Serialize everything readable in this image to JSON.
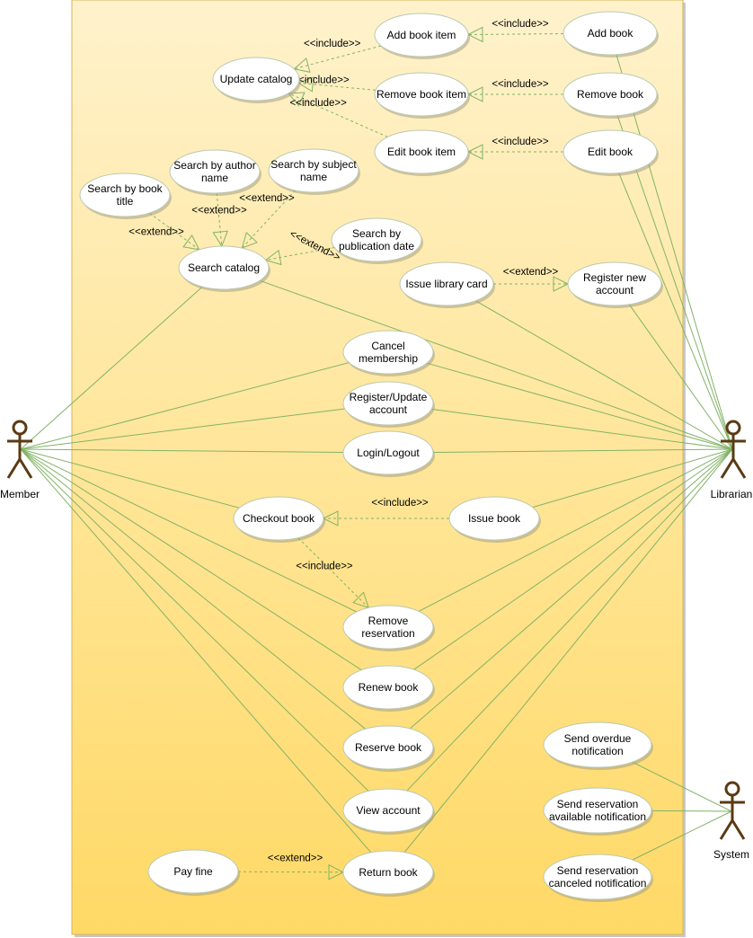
{
  "diagram": {
    "type": "UML use case diagram",
    "colors": {
      "boundary_fill_top": "#fff2cc",
      "boundary_fill_bottom": "#ffd966",
      "boundary_stroke": "#d6b656",
      "association": "#82b366",
      "actor": "#5b3a13",
      "ellipse_fill": "#ffffff"
    }
  },
  "actors": {
    "member": "Member",
    "librarian": "Librarian",
    "system": "System"
  },
  "use_cases": {
    "update_catalog": [
      "Update catalog"
    ],
    "add_book_item": [
      "Add book item"
    ],
    "remove_book_item": [
      "Remove book item"
    ],
    "edit_book_item": [
      "Edit book item"
    ],
    "add_book": [
      "Add book"
    ],
    "remove_book": [
      "Remove book"
    ],
    "edit_book": [
      "Edit book"
    ],
    "search_by_book_title": [
      "Search by book",
      "title"
    ],
    "search_by_author_name": [
      "Search by author",
      "name"
    ],
    "search_by_subject_name": [
      "Search by subject",
      "name"
    ],
    "search_by_publication_date": [
      "Search by",
      "publication date"
    ],
    "search_catalog": [
      "Search catalog"
    ],
    "issue_library_card": [
      "Issue library card"
    ],
    "register_new_account": [
      "Register new",
      "account"
    ],
    "cancel_membership": [
      "Cancel",
      "membership"
    ],
    "register_update_account": [
      "Register/Update",
      "account"
    ],
    "login_logout": [
      "Login/Logout"
    ],
    "checkout_book": [
      "Checkout book"
    ],
    "issue_book": [
      "Issue book"
    ],
    "remove_reservation": [
      "Remove",
      "reservation"
    ],
    "renew_book": [
      "Renew book"
    ],
    "reserve_book": [
      "Reserve book"
    ],
    "view_account": [
      "View account"
    ],
    "pay_fine": [
      "Pay fine"
    ],
    "return_book": [
      "Return book"
    ],
    "send_overdue_notification": [
      "Send overdue",
      "notification"
    ],
    "send_reservation_available_notification": [
      "Send reservation",
      "available notification"
    ],
    "send_reservation_canceled_notification": [
      "Send reservation",
      "canceled notification"
    ]
  },
  "relationships": [
    {
      "from": "add_book_item",
      "to": "update_catalog",
      "label": "<<include>>"
    },
    {
      "from": "remove_book_item",
      "to": "update_catalog",
      "label": "<<include>>"
    },
    {
      "from": "edit_book_item",
      "to": "update_catalog",
      "label": "<<include>>"
    },
    {
      "from": "add_book",
      "to": "add_book_item",
      "label": "<<include>>"
    },
    {
      "from": "remove_book",
      "to": "remove_book_item",
      "label": "<<include>>"
    },
    {
      "from": "edit_book",
      "to": "edit_book_item",
      "label": "<<include>>"
    },
    {
      "from": "search_by_book_title",
      "to": "search_catalog",
      "label": "<<extend>>"
    },
    {
      "from": "search_by_author_name",
      "to": "search_catalog",
      "label": "<<extend>>"
    },
    {
      "from": "search_by_subject_name",
      "to": "search_catalog",
      "label": "<<extend>>"
    },
    {
      "from": "search_by_publication_date",
      "to": "search_catalog",
      "label": "<<extend>>"
    },
    {
      "from": "issue_library_card",
      "to": "register_new_account",
      "label": "<<extend>>"
    },
    {
      "from": "issue_book",
      "to": "checkout_book",
      "label": "<<include>>"
    },
    {
      "from": "checkout_book",
      "to": "remove_reservation",
      "label": "<<include>>"
    },
    {
      "from": "pay_fine",
      "to": "return_book",
      "label": "<<extend>>"
    }
  ],
  "associations": {
    "member": [
      "search_catalog",
      "cancel_membership",
      "register_update_account",
      "login_logout",
      "checkout_book",
      "remove_reservation",
      "renew_book",
      "reserve_book",
      "view_account",
      "return_book"
    ],
    "librarian": [
      "add_book",
      "remove_book",
      "edit_book",
      "search_catalog",
      "issue_library_card",
      "register_new_account",
      "cancel_membership",
      "register_update_account",
      "login_logout",
      "issue_book",
      "remove_reservation",
      "renew_book",
      "reserve_book",
      "view_account",
      "return_book"
    ],
    "system": [
      "send_overdue_notification",
      "send_reservation_available_notification",
      "send_reservation_canceled_notification"
    ]
  }
}
